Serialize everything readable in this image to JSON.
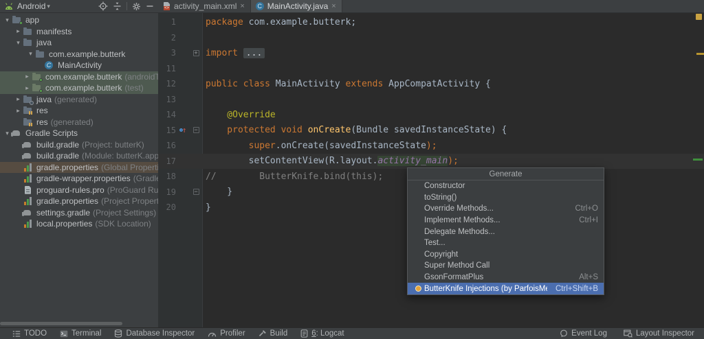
{
  "colors": {
    "panel_bg": "#3c3f41",
    "editor_bg": "#2b2b2b",
    "selection_blue": "#4b6eaf",
    "selected_row_green": "#4e5a50",
    "selected_row_brown": "#564c41",
    "keyword_orange": "#cc7832",
    "annotation_yellow": "#bbb529",
    "method_yellow": "#ffc66d",
    "field_purple": "#9876aa",
    "comment_gray": "#808080",
    "stripe_yellow": "#c9a242",
    "stripe_green": "#3f8f3c"
  },
  "project_header": {
    "title": "Android"
  },
  "tabs": [
    {
      "label": "activity_main.xml"
    },
    {
      "label": "MainActivity.java"
    }
  ],
  "project_tree": [
    {
      "label": "app"
    },
    {
      "label": "manifests"
    },
    {
      "label": "java"
    },
    {
      "label": "com.example.butterk"
    },
    {
      "label": "MainActivity"
    },
    {
      "label": "com.example.butterk",
      "annotation": "(androidTest)"
    },
    {
      "label": "com.example.butterk",
      "annotation": "(test)"
    },
    {
      "label": "java",
      "annotation": "(generated)"
    },
    {
      "label": "res"
    },
    {
      "label": "res",
      "annotation": "(generated)"
    },
    {
      "label": "Gradle Scripts"
    },
    {
      "label": "build.gradle",
      "annotation": "(Project: butterK)"
    },
    {
      "label": "build.gradle",
      "annotation": "(Module: butterK.app)"
    },
    {
      "label": "gradle.properties",
      "annotation": "(Global Properties)"
    },
    {
      "label": "gradle-wrapper.properties",
      "annotation": "(Gradle Vers"
    },
    {
      "label": "proguard-rules.pro",
      "annotation": "(ProGuard Rules fo"
    },
    {
      "label": "gradle.properties",
      "annotation": "(Project Properties)"
    },
    {
      "label": "settings.gradle",
      "annotation": "(Project Settings)"
    },
    {
      "label": "local.properties",
      "annotation": "(SDK Location)"
    }
  ],
  "editor": {
    "lines": [
      {
        "n": "1",
        "tokens": [
          {
            "t": "package "
          },
          {
            "t": "com.example.butterk;"
          }
        ]
      },
      {
        "n": "2"
      },
      {
        "n": "3",
        "tokens": [
          {
            "t": "import "
          },
          {
            "t": "..."
          }
        ]
      },
      {
        "n": "11"
      },
      {
        "n": "12",
        "tokens": [
          {
            "t": "public class "
          },
          {
            "t": "MainActivity "
          },
          {
            "t": "extends "
          },
          {
            "t": "AppCompatActivity {"
          }
        ]
      },
      {
        "n": "13"
      },
      {
        "n": "14",
        "tokens": [
          {
            "t": "    @Override"
          }
        ]
      },
      {
        "n": "15",
        "tokens": [
          {
            "t": "    protected void "
          },
          {
            "t": "onCreate"
          },
          {
            "t": "(Bundle savedInstanceState) {"
          }
        ]
      },
      {
        "n": "16",
        "tokens": [
          {
            "t": "        super"
          },
          {
            "t": ".onCreate(savedInstanceState"
          },
          {
            "t": ");"
          }
        ]
      },
      {
        "n": "17",
        "tokens": [
          {
            "t": "        setContentView(R.layout."
          },
          {
            "t": "activity_main"
          },
          {
            "t": ");"
          }
        ]
      },
      {
        "n": "18",
        "tokens": [
          {
            "t": "//        ButterKnife.bind(this);"
          }
        ]
      },
      {
        "n": "19",
        "tokens": [
          {
            "t": "    }"
          }
        ]
      },
      {
        "n": "20",
        "tokens": [
          {
            "t": "}"
          }
        ]
      }
    ]
  },
  "popup": {
    "title": "Generate",
    "items": [
      {
        "label": "Constructor"
      },
      {
        "label": "toString()"
      },
      {
        "label": "Override Methods...",
        "shortcut": "Ctrl+O"
      },
      {
        "label": "Implement Methods...",
        "shortcut": "Ctrl+I"
      },
      {
        "label": "Delegate Methods..."
      },
      {
        "label": "Test..."
      },
      {
        "label": "Copyright"
      },
      {
        "label": "Super Method Call"
      },
      {
        "label": "GsonFormatPlus",
        "shortcut": "Alt+S"
      },
      {
        "label": "ButterKnife Injections (by ParfoisMeng)",
        "shortcut": "Ctrl+Shift+B"
      }
    ]
  },
  "status_bar": {
    "left": [
      {
        "label": "TODO"
      },
      {
        "label": "Terminal"
      },
      {
        "label": "Database Inspector"
      },
      {
        "label": "Profiler"
      },
      {
        "label": "Build"
      },
      {
        "mnemonic": "6",
        "label": ": Logcat"
      }
    ],
    "right": [
      {
        "label": "Event Log"
      },
      {
        "label": "Layout Inspector"
      }
    ]
  }
}
